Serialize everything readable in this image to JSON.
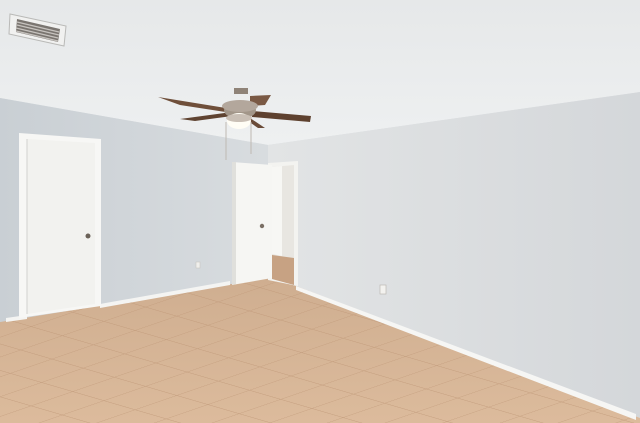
{
  "scene": {
    "kind": "empty-room-photo",
    "colors": {
      "ceiling": "#e9ebec",
      "left_wall": "#d3d8dc",
      "right_wall": "#dcdfe1",
      "floor_tile": "#d6b596",
      "floor_grout": "#c39c7c",
      "door": "#f3f3f1",
      "baseboard": "#f6f6f4",
      "fan_blade": "#6a4b38",
      "fan_metal": "#9a8f86"
    },
    "objects": {
      "ceiling_vent": "hvac-vent-icon",
      "ceiling_fan": "ceiling-fan-icon",
      "closet_door": "door-icon",
      "open_door": "door-icon",
      "outlet": "outlet-icon"
    }
  }
}
